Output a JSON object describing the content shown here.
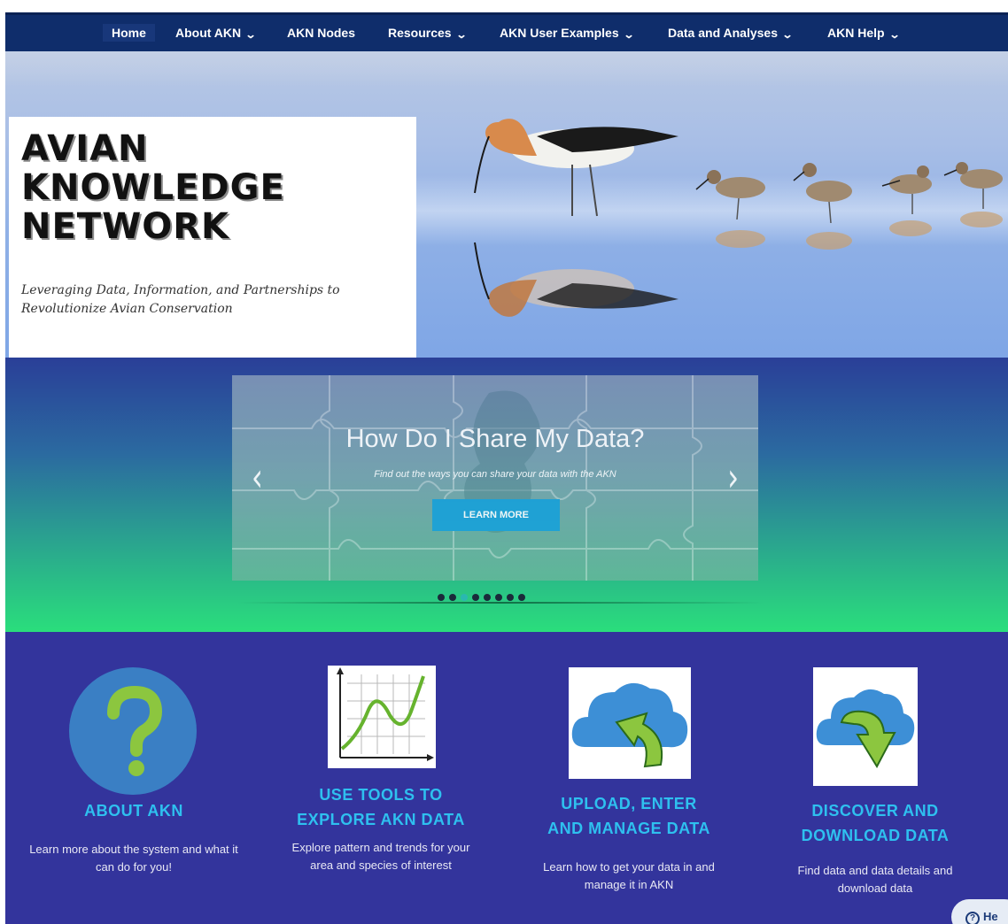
{
  "nav": {
    "items": [
      {
        "label": "Home",
        "dropdown": false
      },
      {
        "label": "About AKN",
        "dropdown": true
      },
      {
        "label": "AKN Nodes",
        "dropdown": false
      },
      {
        "label": "Resources",
        "dropdown": true
      },
      {
        "label": "AKN User Examples",
        "dropdown": true
      },
      {
        "label": "Data and Analyses",
        "dropdown": true
      },
      {
        "label": "AKN Help",
        "dropdown": true
      }
    ],
    "chevron": "⌄"
  },
  "hero": {
    "title_line1": "AVIAN",
    "title_line2": "KNOWLEDGE",
    "title_line3": "NETWORK",
    "tagline": "Leveraging Data, Information, and Partnerships to Revolutionize Avian Conservation"
  },
  "carousel": {
    "title": "How Do I Share My Data?",
    "subtitle": "Find out the ways you can share your data with the AKN",
    "button_label": "LEARN MORE",
    "prev_glyph": "‹",
    "next_glyph": "›",
    "slide_count": 8,
    "active_index": 2
  },
  "features": [
    {
      "title_line1": "ABOUT AKN",
      "title_line2": "",
      "desc": "Learn more about the system and what it can do for you!",
      "icon": "question-mark-icon"
    },
    {
      "title_line1": "USE TOOLS TO",
      "title_line2": "EXPLORE AKN DATA",
      "desc": "Explore pattern and trends for your area and species of interest",
      "icon": "line-chart-icon"
    },
    {
      "title_line1": "UPLOAD, ENTER",
      "title_line2": "AND MANAGE DATA",
      "desc": "Learn how to get your data in and manage it in AKN",
      "icon": "cloud-upload-icon"
    },
    {
      "title_line1": "DISCOVER AND",
      "title_line2": "DOWNLOAD DATA",
      "desc": "Find data and data details and download data",
      "icon": "cloud-download-icon"
    }
  ],
  "help_widget": {
    "label": "He",
    "icon": "help-circle-icon"
  },
  "colors": {
    "nav_bg": "#0f2d6b",
    "feature_bg": "#33349c",
    "feature_title": "#2ec0ef",
    "button_blue": "#1fa3da",
    "gradient_top": "#2a3f98",
    "gradient_bottom": "#2ade7c"
  }
}
